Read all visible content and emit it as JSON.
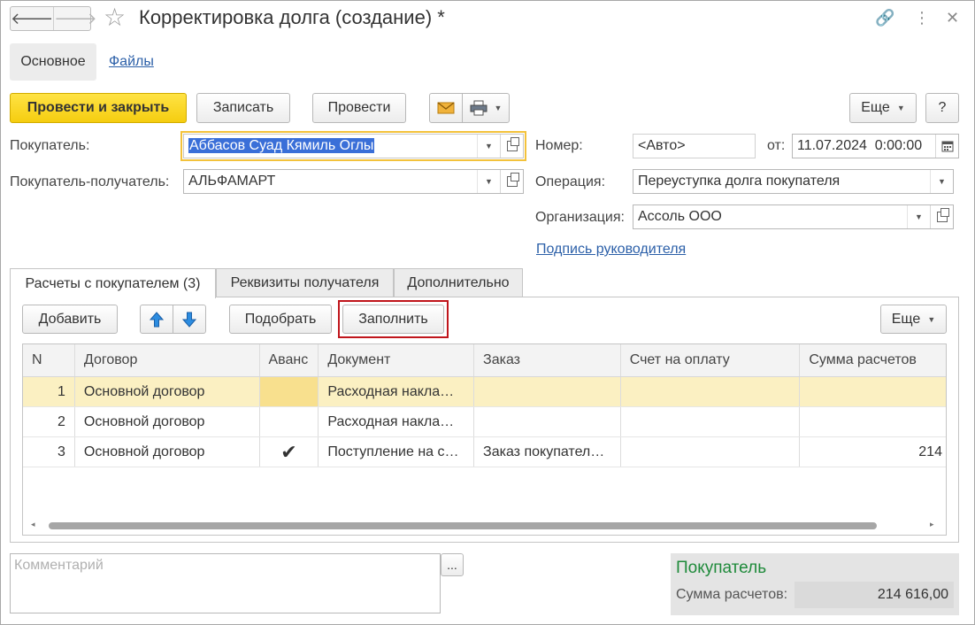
{
  "window": {
    "title": "Корректировка долга (создание) *",
    "controls": {
      "link": "🔗",
      "more": "⋮",
      "close": "✕"
    }
  },
  "nav": {
    "back": "🡐",
    "forward": "🡒"
  },
  "form_tabs": [
    {
      "label": "Основное",
      "active": true
    },
    {
      "label": "Файлы",
      "active": false
    }
  ],
  "toolbar": {
    "post_close": "Провести и закрыть",
    "save": "Записать",
    "post": "Провести",
    "more": "Еще",
    "help": "?"
  },
  "fields": {
    "buyer": {
      "label": "Покупатель:",
      "value": "Аббасов Суад Кямиль Оглы"
    },
    "receiver": {
      "label": "Покупатель-получатель:",
      "value": "АЛЬФАМАРТ"
    },
    "number": {
      "label": "Номер:",
      "placeholder": "<Авто>"
    },
    "date": {
      "label": "от:",
      "value": "11.07.2024  0:00:00"
    },
    "operation": {
      "label": "Операция:",
      "value": "Переуступка долга покупателя"
    },
    "organization": {
      "label": "Организация:",
      "value": "Ассоль ООО"
    },
    "signature_link": "Подпись руководителя"
  },
  "content_tabs": [
    {
      "label": "Расчеты с покупателем (3)",
      "active": true
    },
    {
      "label": "Реквизиты получателя",
      "active": false
    },
    {
      "label": "Дополнительно",
      "active": false
    }
  ],
  "table_toolbar": {
    "add": "Добавить",
    "pick": "Подобрать",
    "fill": "Заполнить",
    "more": "Еще"
  },
  "table": {
    "columns": [
      "N",
      "Договор",
      "Аванс",
      "Документ",
      "Заказ",
      "Счет на оплату",
      "Сумма расчетов"
    ],
    "rows": [
      {
        "n": "1",
        "contract": "Основной договор",
        "advance": "",
        "document": "Расходная накла…",
        "order": "",
        "invoice": "",
        "sum": ""
      },
      {
        "n": "2",
        "contract": "Основной договор",
        "advance": "",
        "document": "Расходная накла…",
        "order": "",
        "invoice": "",
        "sum": ""
      },
      {
        "n": "3",
        "contract": "Основной договор",
        "advance": "✔",
        "document": "Поступление на с…",
        "order": "Заказ покупател…",
        "invoice": "",
        "sum": "214"
      }
    ]
  },
  "comment": {
    "placeholder": "Комментарий",
    "button": "..."
  },
  "summary": {
    "title": "Покупатель",
    "label": "Сумма расчетов:",
    "value": "214 616,00"
  },
  "colors": {
    "primary": "#f5cd10",
    "link": "#2b5fa8",
    "highlight": "#c0161c",
    "summary_title": "#1e8a3a",
    "current_row": "#fbf0c2"
  }
}
